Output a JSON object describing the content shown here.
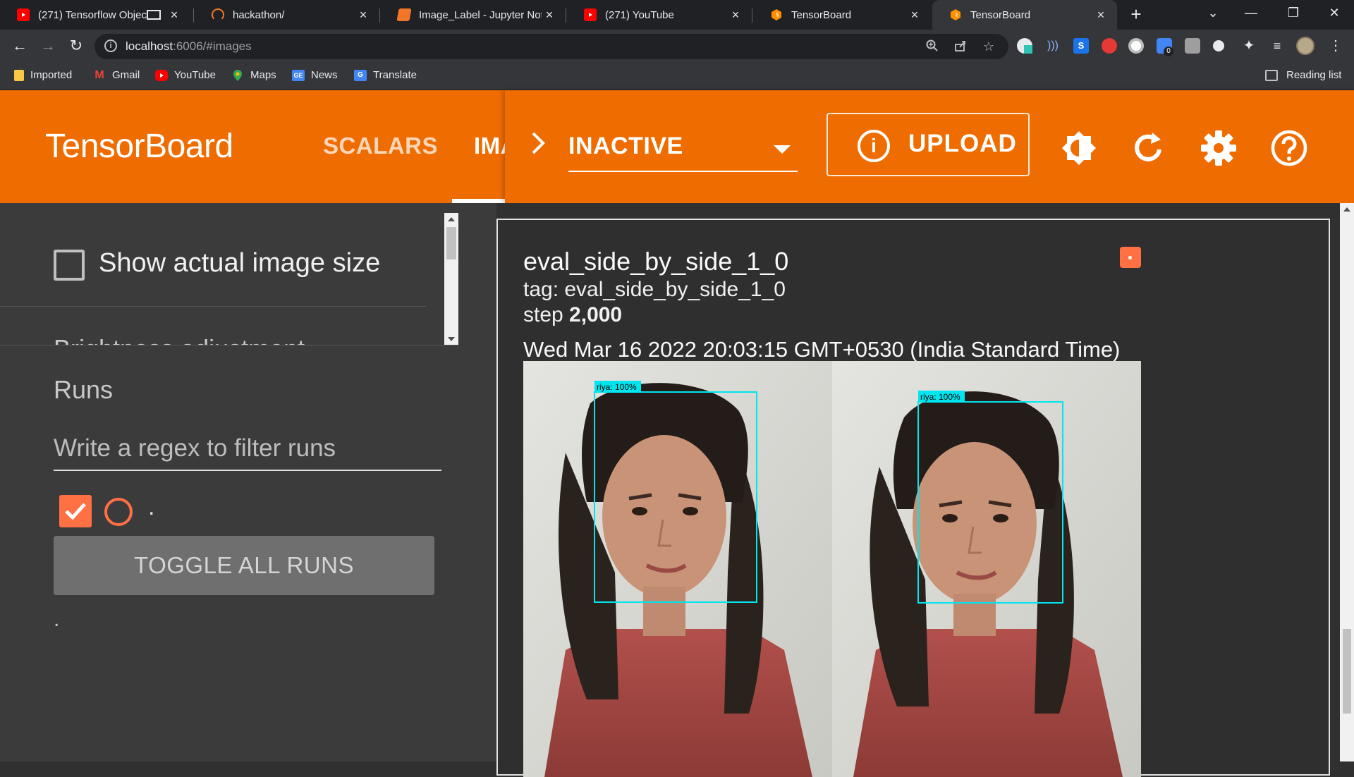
{
  "browser": {
    "tabs": [
      {
        "title": "(271) Tensorflow Objec",
        "favicon": "youtube-icon",
        "color": "#ff0000"
      },
      {
        "title": "hackathon/",
        "favicon": "jupyter-icon",
        "color": "#f37626"
      },
      {
        "title": "Image_Label - Jupyter Note",
        "favicon": "notebook-icon",
        "color": "#f37626"
      },
      {
        "title": "(271) YouTube",
        "favicon": "youtube-icon",
        "color": "#ff0000"
      },
      {
        "title": "TensorBoard",
        "favicon": "tensorboard-icon",
        "color": "#ff8f00"
      },
      {
        "title": "TensorBoard",
        "favicon": "tensorboard-icon",
        "color": "#ff8f00"
      }
    ],
    "url_host": "localhost",
    "url_rest": ":6006/#images",
    "bookmarks": [
      {
        "label": "Imported",
        "icon": "folder-icon",
        "color": "#f9c846"
      },
      {
        "label": "Gmail",
        "icon": "gmail-icon",
        "color": "#ea4335"
      },
      {
        "label": "YouTube",
        "icon": "youtube-icon",
        "color": "#ff0000"
      },
      {
        "label": "Maps",
        "icon": "maps-icon",
        "color": "#34a853"
      },
      {
        "label": "News",
        "icon": "news-icon",
        "color": "#4285f4"
      },
      {
        "label": "Translate",
        "icon": "translate-icon",
        "color": "#4285f4"
      }
    ],
    "reading_list": "Reading list",
    "extension_badge": "0"
  },
  "header": {
    "logo": "TensorBoard",
    "tabs": [
      "SCALARS",
      "IMA"
    ],
    "active_tab": "IMA",
    "run_selector": "INACTIVE",
    "upload_label": "UPLOAD",
    "accent_color": "#ef6c00"
  },
  "sidebar": {
    "show_actual_size_label": "Show actual image size",
    "show_actual_size_checked": false,
    "brightness_label": "Brightness adjustment",
    "runs_title": "Runs",
    "regex_placeholder": "Write a regex to filter runs",
    "run_name": ".",
    "run_checked": true,
    "toggle_all_label": "TOGGLE ALL RUNS",
    "footer_dot": "."
  },
  "card": {
    "title": "eval_side_by_side_1_0",
    "tag": "tag: eval_side_by_side_1_0",
    "step_prefix": "step ",
    "step_value": "2,000",
    "timestamp": "Wed Mar 16 2022 20:03:15 GMT+0530 (India Standard Time)",
    "detections": [
      {
        "label": "riya: 100%"
      },
      {
        "label": "riya: 100%"
      }
    ]
  }
}
